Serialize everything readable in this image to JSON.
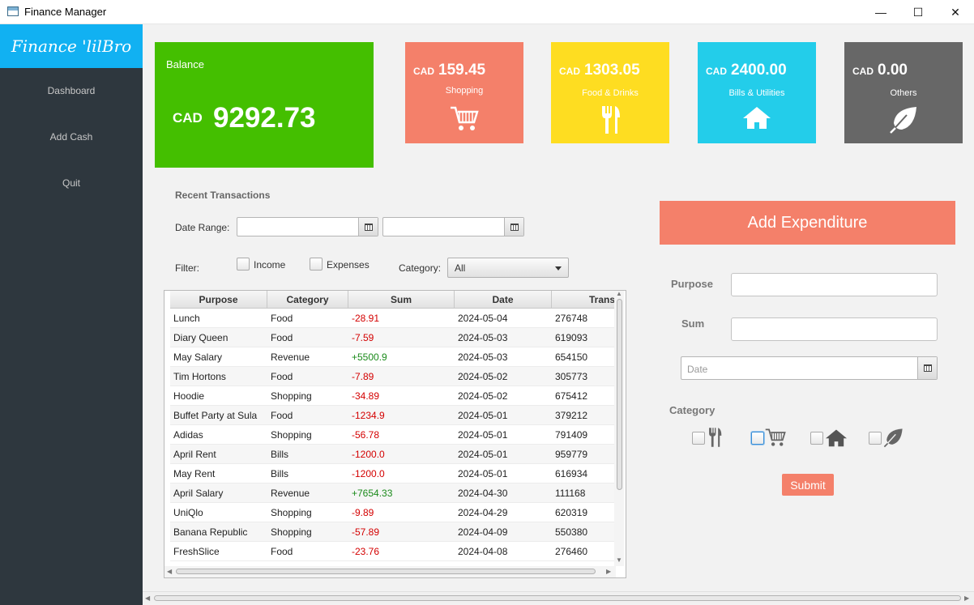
{
  "window": {
    "title": "Finance Manager",
    "min_glyph": "—",
    "max_glyph": "☐",
    "close_glyph": "✕"
  },
  "sidebar": {
    "logo": "Finance 'lilBro",
    "items": [
      {
        "label": "Dashboard"
      },
      {
        "label": "Add Cash"
      },
      {
        "label": "Quit"
      }
    ]
  },
  "balance": {
    "label": "Balance",
    "currency": "CAD",
    "value": "9292.73"
  },
  "categories": [
    {
      "currency": "CAD",
      "value": "159.45",
      "label": "Shopping",
      "color": "#f4806a",
      "icon": "cart-icon"
    },
    {
      "currency": "CAD",
      "value": "1303.05",
      "label": "Food & Drinks",
      "color": "#fedd21",
      "icon": "fork-knife-icon"
    },
    {
      "currency": "CAD",
      "value": "2400.00",
      "label": "Bills & Utilities",
      "color": "#23cdea",
      "icon": "house-icon"
    },
    {
      "currency": "CAD",
      "value": "0.00",
      "label": "Others",
      "color": "#676767",
      "icon": "leaf-icon"
    }
  ],
  "transactions": {
    "title": "Recent Transactions",
    "date_range_label": "Date Range:",
    "filter_label": "Filter:",
    "income_label": "Income",
    "expenses_label": "Expenses",
    "category_label": "Category:",
    "category_value": "All",
    "columns": [
      "Purpose",
      "Category",
      "Sum",
      "Date",
      "Trans"
    ],
    "rows": [
      [
        "Lunch",
        "Food",
        "-28.91",
        "2024-05-04",
        "276748"
      ],
      [
        "Diary Queen",
        "Food",
        "-7.59",
        "2024-05-03",
        "619093"
      ],
      [
        "May Salary",
        "Revenue",
        "+5500.9",
        "2024-05-03",
        "654150"
      ],
      [
        "Tim Hortons",
        "Food",
        "-7.89",
        "2024-05-02",
        "305773"
      ],
      [
        "Hoodie",
        "Shopping",
        "-34.89",
        "2024-05-02",
        "675412"
      ],
      [
        "Buffet Party at Sula",
        "Food",
        "-1234.9",
        "2024-05-01",
        "379212"
      ],
      [
        "Adidas",
        "Shopping",
        "-56.78",
        "2024-05-01",
        "791409"
      ],
      [
        "April Rent",
        "Bills",
        "-1200.0",
        "2024-05-01",
        "959779"
      ],
      [
        "May Rent",
        "Bills",
        "-1200.0",
        "2024-05-01",
        "616934"
      ],
      [
        "April Salary",
        "Revenue",
        "+7654.33",
        "2024-04-30",
        "111168"
      ],
      [
        "UniQlo",
        "Shopping",
        "-9.89",
        "2024-04-29",
        "620319"
      ],
      [
        "Banana Republic",
        "Shopping",
        "-57.89",
        "2024-04-09",
        "550380"
      ],
      [
        "FreshSlice",
        "Food",
        "-23.76",
        "2024-04-08",
        "276460"
      ]
    ]
  },
  "expenditure": {
    "title": "Add Expenditure",
    "purpose_label": "Purpose",
    "sum_label": "Sum",
    "date_placeholder": "Date",
    "category_label": "Category",
    "submit_label": "Submit"
  }
}
